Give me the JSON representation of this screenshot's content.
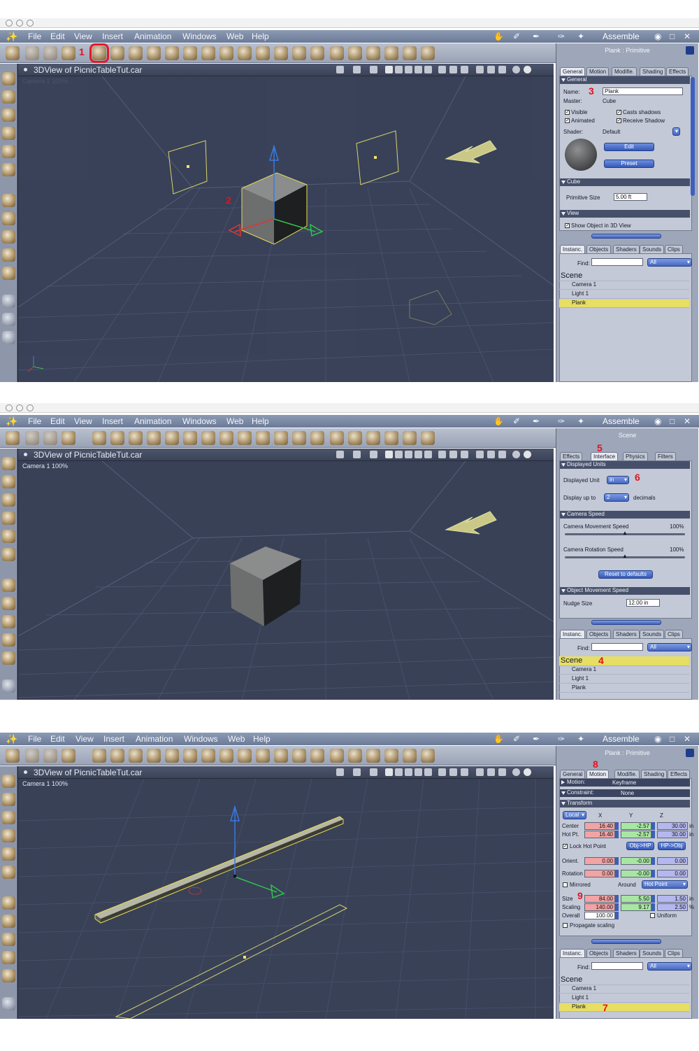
{
  "app": {
    "menus": [
      "File",
      "Edit",
      "View",
      "Insert",
      "Animation",
      "Windows",
      "Web",
      "Help"
    ],
    "room": "Assemble",
    "viewport_title": "3DView of PicnicTableTut.car",
    "camera_label": "Camera 1 100%"
  },
  "colors": {
    "menubar": "#7b89a4",
    "viewport": "#394157",
    "panel": "#9ea7b9",
    "selection": "#e7de64",
    "annotation": "#e3121f"
  },
  "icons": [
    "brush-icon",
    "hand-icon",
    "paint-icon",
    "pointer-icon",
    "cube-icon",
    "cylinder-icon",
    "sphere-icon",
    "torus-icon",
    "cone-icon",
    "text-icon",
    "gear-icon",
    "plane-icon",
    "tree-icon",
    "bone-icon",
    "camera-icon",
    "zoom-icon"
  ],
  "shot1": {
    "annotations": [
      "1",
      "2",
      "3"
    ],
    "panel_header": "Plank : Primitive",
    "tabs": [
      "General",
      "Motion",
      "Modifie.",
      "Shading",
      "Effects"
    ],
    "general_section": "General",
    "name_label": "Name:",
    "name_value": "Plank",
    "master_label": "Master:",
    "master_value": "Cube",
    "visible": "Visible",
    "casts_shadows": "Casts shadows",
    "animated": "Animated",
    "receive_shadow": "Receive Shadow",
    "shader_label": "Shader:",
    "shader_value": "Default",
    "edit_btn": "Edit",
    "preset_btn": "Preset",
    "cube_section": "Cube",
    "primitive_size_label": "Primitive Size",
    "primitive_size_value": "5.00 ft",
    "view_section": "View",
    "show_object": "Show Object in 3D View",
    "browser_tabs": [
      "Instanc.",
      "Objects",
      "Shaders",
      "Sounds",
      "Clips"
    ],
    "find_label": "Find:",
    "find_filter": "All",
    "scene": "Scene",
    "items": [
      "Camera 1",
      "Light 1",
      "Plank"
    ]
  },
  "shot2": {
    "annotations": [
      "5",
      "6",
      "4"
    ],
    "panel_header": "Scene",
    "tabs": [
      "Effects",
      "Interface",
      "Physics",
      "Filters"
    ],
    "units_section": "Displayed Units",
    "displayed_unit_label": "Displayed Unit",
    "displayed_unit_value": "in",
    "display_up_to_label": "Display up to",
    "display_up_to_value": "2",
    "decimals_label": "decimals",
    "camera_speed_section": "Camera Speed",
    "cam_move_label": "Camera Movement Speed",
    "cam_move_value": "100%",
    "cam_rot_label": "Camera Rotation Speed",
    "cam_rot_value": "100%",
    "reset_btn": "Reset to defaults",
    "object_speed_section": "Object Movement Speed",
    "nudge_label": "Nudge Size",
    "nudge_value": "12.00 in",
    "browser_tabs": [
      "Instanc.",
      "Objects",
      "Shaders",
      "Sounds",
      "Clips"
    ],
    "find_label": "Find:",
    "find_filter": "All",
    "scene": "Scene",
    "items": [
      "Camera 1",
      "Light 1",
      "Plank"
    ]
  },
  "shot3": {
    "annotations": [
      "8",
      "9",
      "7"
    ],
    "panel_header": "Plank : Primitive",
    "tabs": [
      "General",
      "Motion",
      "Modifie.",
      "Shading",
      "Effects"
    ],
    "motion_label": "Motion:",
    "motion_value": "Keyframe",
    "constraint_label": "Constraint:",
    "constraint_value": "None",
    "transform_section": "Transform",
    "local_value": "Local",
    "axis_x": "X",
    "axis_y": "Y",
    "axis_z": "Z",
    "rows": [
      {
        "label": "Center",
        "x": "16.40",
        "y": "-2.57",
        "z": "30.00",
        "unit": "in"
      },
      {
        "label": "Hot Pt.",
        "x": "16.40",
        "y": "-2.57",
        "z": "30.00",
        "unit": "in"
      }
    ],
    "lock_hot_point": "Lock Hot Point",
    "obj_hp_btn": "Obj->HP",
    "hp_obj_btn": "HP->Obj",
    "orient": {
      "label": "Orient.",
      "x": "0.00",
      "y": "-0.00",
      "z": "0.00"
    },
    "rotation": {
      "label": "Rotation",
      "x": "0.00",
      "y": "-0.00",
      "z": "0.00"
    },
    "mirrored": "Mirrored",
    "around_label": "Around",
    "around_value": "Hot Point",
    "size": {
      "label": "Size",
      "x": "84.00",
      "y": "5.50",
      "z": "1.50",
      "unit": "in"
    },
    "scaling": {
      "label": "Scaling",
      "x": "140.00",
      "y": "9.17",
      "z": "2.50",
      "unit": "%"
    },
    "overall_label": "Overall",
    "overall_value": "100.00",
    "uniform": "Uniform",
    "propagate": "Propagate scaling",
    "browser_tabs": [
      "Instanc.",
      "Objects",
      "Shaders",
      "Sounds",
      "Clips"
    ],
    "find_label": "Find:",
    "find_filter": "All",
    "scene": "Scene",
    "items": [
      "Camera 1",
      "Light 1",
      "Plank"
    ]
  }
}
